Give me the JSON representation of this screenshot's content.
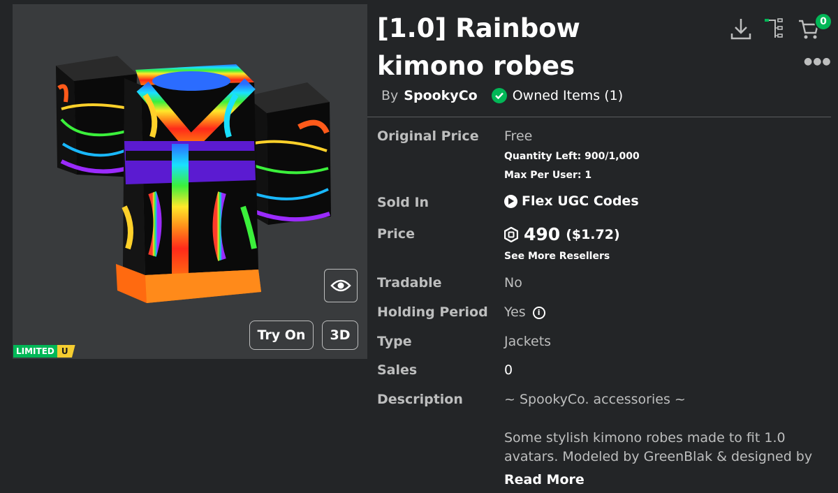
{
  "item": {
    "title": "[1.0] Rainbow kimono robes",
    "by_label": "By",
    "creator": "SpookyCo",
    "owned_label": "Owned Items (1)"
  },
  "preview": {
    "try_on_label": "Try On",
    "three_d_label": "3D",
    "limited_label": "LIMITED",
    "limited_u_label": "U",
    "view_icon": "eye-icon"
  },
  "header": {
    "cart_count": "0",
    "icons": [
      "download-icon",
      "tree-icon",
      "cart-icon",
      "more-icon"
    ]
  },
  "details": {
    "original_price_label": "Original Price",
    "original_price_value": "Free",
    "quantity_left": "Quantity Left: 900/1,000",
    "max_per_user": "Max Per User: 1",
    "sold_in_label": "Sold In",
    "sold_in_value": "Flex UGC Codes",
    "price_label": "Price",
    "price_robux": "490",
    "price_usd": "($1.72)",
    "see_more_resellers": "See More Resellers",
    "tradable_label": "Tradable",
    "tradable_value": "No",
    "holding_period_label": "Holding Period",
    "holding_period_value": "Yes",
    "type_label": "Type",
    "type_value": "Jackets",
    "sales_label": "Sales",
    "sales_value": "0",
    "description_label": "Description",
    "description_line1": "~ SpookyCo. accessories ~",
    "description_body": "Some stylish kimono robes made to fit 1.0 avatars. Modeled by GreenBlak & designed by",
    "read_more": "Read More"
  },
  "colors": {
    "background": "#232527",
    "panel": "#393b3d",
    "green": "#02b757",
    "muted_text": "#bdbebe"
  }
}
